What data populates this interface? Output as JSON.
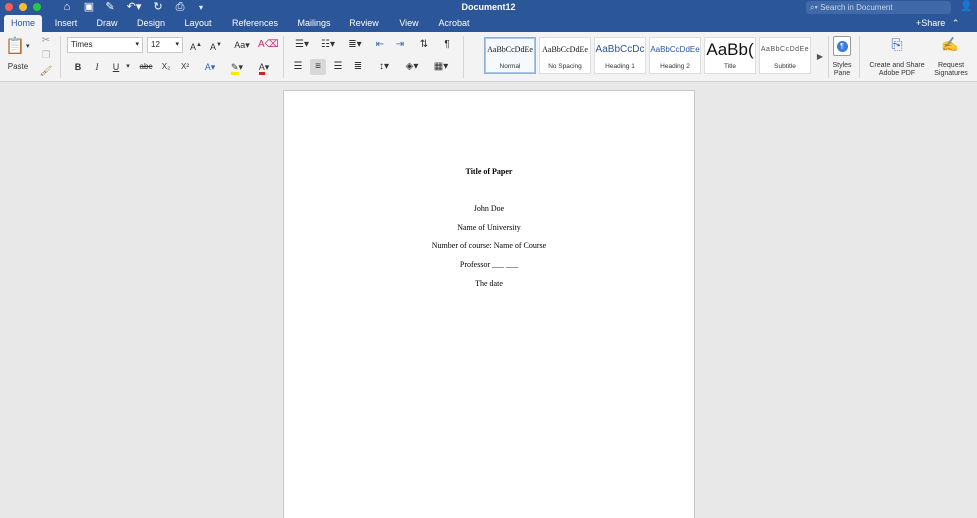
{
  "app": {
    "document_title": "Document12",
    "search_placeholder": "Search in Document",
    "share_label": "Share"
  },
  "tabs": [
    {
      "label": "Home",
      "active": true
    },
    {
      "label": "Insert"
    },
    {
      "label": "Draw"
    },
    {
      "label": "Design"
    },
    {
      "label": "Layout"
    },
    {
      "label": "References"
    },
    {
      "label": "Mailings"
    },
    {
      "label": "Review"
    },
    {
      "label": "View"
    },
    {
      "label": "Acrobat"
    }
  ],
  "ribbon": {
    "paste_label": "Paste",
    "font_name": "Times",
    "font_size": "12",
    "bold": "B",
    "italic": "I",
    "underline": "U",
    "strikethrough": "abc",
    "subscript": "X₂",
    "superscript": "X²",
    "styles": [
      {
        "sample": "AaBbCcDdEe",
        "label": "Normal",
        "selected": true
      },
      {
        "sample": "AaBbCcDdEe",
        "label": "No Spacing"
      },
      {
        "sample": "AaBbCcDc",
        "label": "Heading 1"
      },
      {
        "sample": "AaBbCcDdEe",
        "label": "Heading 2"
      },
      {
        "sample": "AaBb(",
        "label": "Title"
      },
      {
        "sample": "AaBbCcDdEe",
        "label": "Subtitle"
      }
    ],
    "styles_pane_label": "Styles Pane",
    "create_pdf_label": "Create and Share Adobe PDF",
    "request_signatures_label": "Request Signatures"
  },
  "document": {
    "title": "Title of Paper",
    "author": "John Doe",
    "university": "Name of University",
    "course": "Number of course: Name of Course",
    "professor": "Professor ___ ___",
    "date": "The date"
  },
  "colors": {
    "accent": "#2b579a",
    "ribbon_bg": "#f3f3f3",
    "canvas_bg": "#e8e8e8"
  }
}
